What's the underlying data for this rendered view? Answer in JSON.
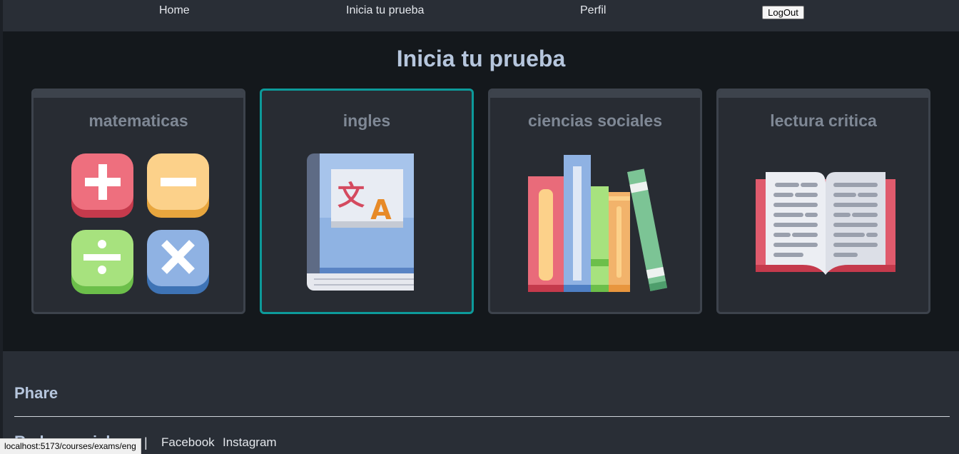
{
  "nav": {
    "home": "Home",
    "start_test": "Inicia tu prueba",
    "profile": "Perfil",
    "logout": "LogOut"
  },
  "main": {
    "title": "Inicia tu prueba",
    "courses": [
      {
        "title": "matematicas",
        "icon": "math-operations-icon"
      },
      {
        "title": "ingles",
        "icon": "translation-book-icon"
      },
      {
        "title": "ciencias sociales",
        "icon": "books-icon"
      },
      {
        "title": "lectura critica",
        "icon": "open-book-icon"
      }
    ]
  },
  "footer": {
    "brand": "Phare",
    "social_title": "Redes sociales",
    "separator": "|",
    "links": [
      "Facebook",
      "Instagram"
    ]
  },
  "status_url": "localhost:5173/courses/exams/eng",
  "colors": {
    "accent": "#0d9a9a",
    "background": "#14181c",
    "header": "#292e36",
    "card": "#282c33",
    "title": "#b6c6dd"
  }
}
